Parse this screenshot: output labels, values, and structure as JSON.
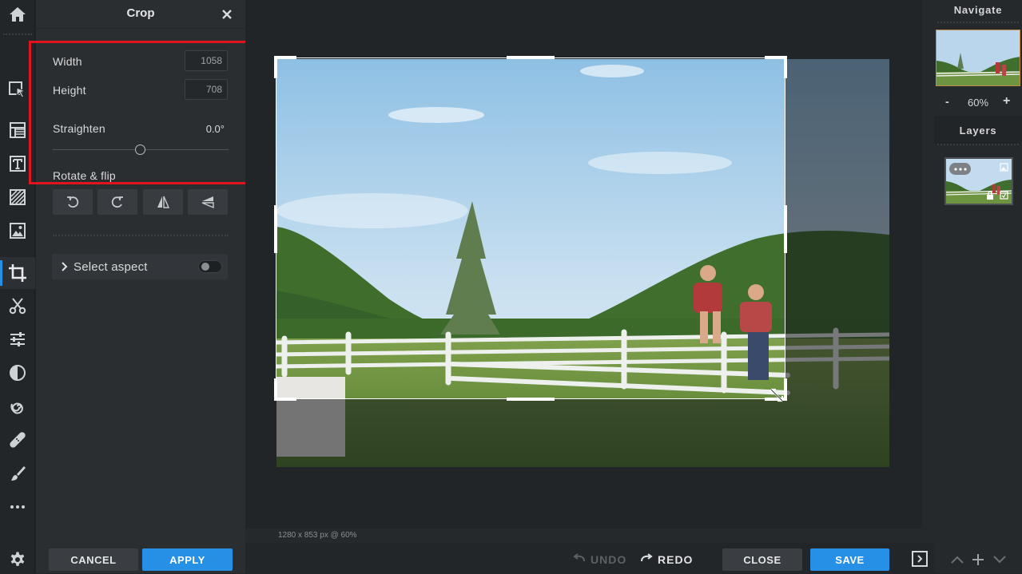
{
  "toolbar": {
    "items": [
      {
        "id": "home",
        "icon": "home-icon"
      },
      {
        "id": "arrange",
        "icon": "arrange-select-icon"
      },
      {
        "id": "layers-panel",
        "icon": "layer-stack-icon"
      },
      {
        "id": "text",
        "icon": "text-icon"
      },
      {
        "id": "pattern",
        "icon": "pattern-fill-icon"
      },
      {
        "id": "image",
        "icon": "image-icon"
      },
      {
        "id": "crop",
        "icon": "crop-icon",
        "active": true
      },
      {
        "id": "cutout",
        "icon": "scissors-icon"
      },
      {
        "id": "adjust",
        "icon": "sliders-icon"
      },
      {
        "id": "effects",
        "icon": "contrast-icon"
      },
      {
        "id": "liquify",
        "icon": "spiral-icon"
      },
      {
        "id": "retouch",
        "icon": "bandage-icon"
      },
      {
        "id": "draw",
        "icon": "brush-icon"
      },
      {
        "id": "more",
        "icon": "more-dots-icon"
      },
      {
        "id": "settings",
        "icon": "gear-icon"
      }
    ]
  },
  "panel": {
    "title": "Crop",
    "width_label": "Width",
    "width_value": "1058",
    "height_label": "Height",
    "height_value": "708",
    "straighten_label": "Straighten",
    "straighten_value": "0.0°",
    "straighten_level": 0.5,
    "rotate_label": "Rotate & flip",
    "rotate_buttons": [
      "rotate-left-icon",
      "rotate-right-icon",
      "flip-horizontal-icon",
      "flip-vertical-icon"
    ],
    "aspect_label": "Select aspect",
    "aspect_enabled": false,
    "cancel": "CANCEL",
    "apply": "APPLY"
  },
  "canvas": {
    "status": "1280 x 853 px @ 60%"
  },
  "bottom": {
    "undo": "UNDO",
    "redo": "REDO",
    "close": "CLOSE",
    "save": "SAVE"
  },
  "navigate": {
    "title": "Navigate",
    "zoom": "60%",
    "zoom_out": "-",
    "zoom_in": "+"
  },
  "layers": {
    "title": "Layers"
  },
  "colors": {
    "accent": "#2590e6",
    "highlight_box": "#e0141e",
    "panel_bg": "#2b2e31",
    "app_bg": "#222528"
  }
}
